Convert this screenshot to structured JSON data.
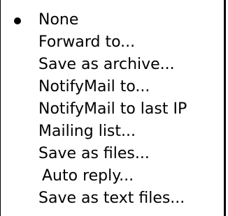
{
  "menu": {
    "items": [
      {
        "label": "None",
        "checked": true
      },
      {
        "label": "Forward to...",
        "checked": false
      },
      {
        "label": "Save as archive...",
        "checked": false
      },
      {
        "label": "NotifyMail to...",
        "checked": false
      },
      {
        "label": "NotifyMail to last IP",
        "checked": false
      },
      {
        "label": "Mailing list...",
        "checked": false
      },
      {
        "label": "Save as files...",
        "checked": false
      },
      {
        "label": "Auto reply...",
        "checked": false
      },
      {
        "label": "Save as text files...",
        "checked": false
      }
    ]
  }
}
